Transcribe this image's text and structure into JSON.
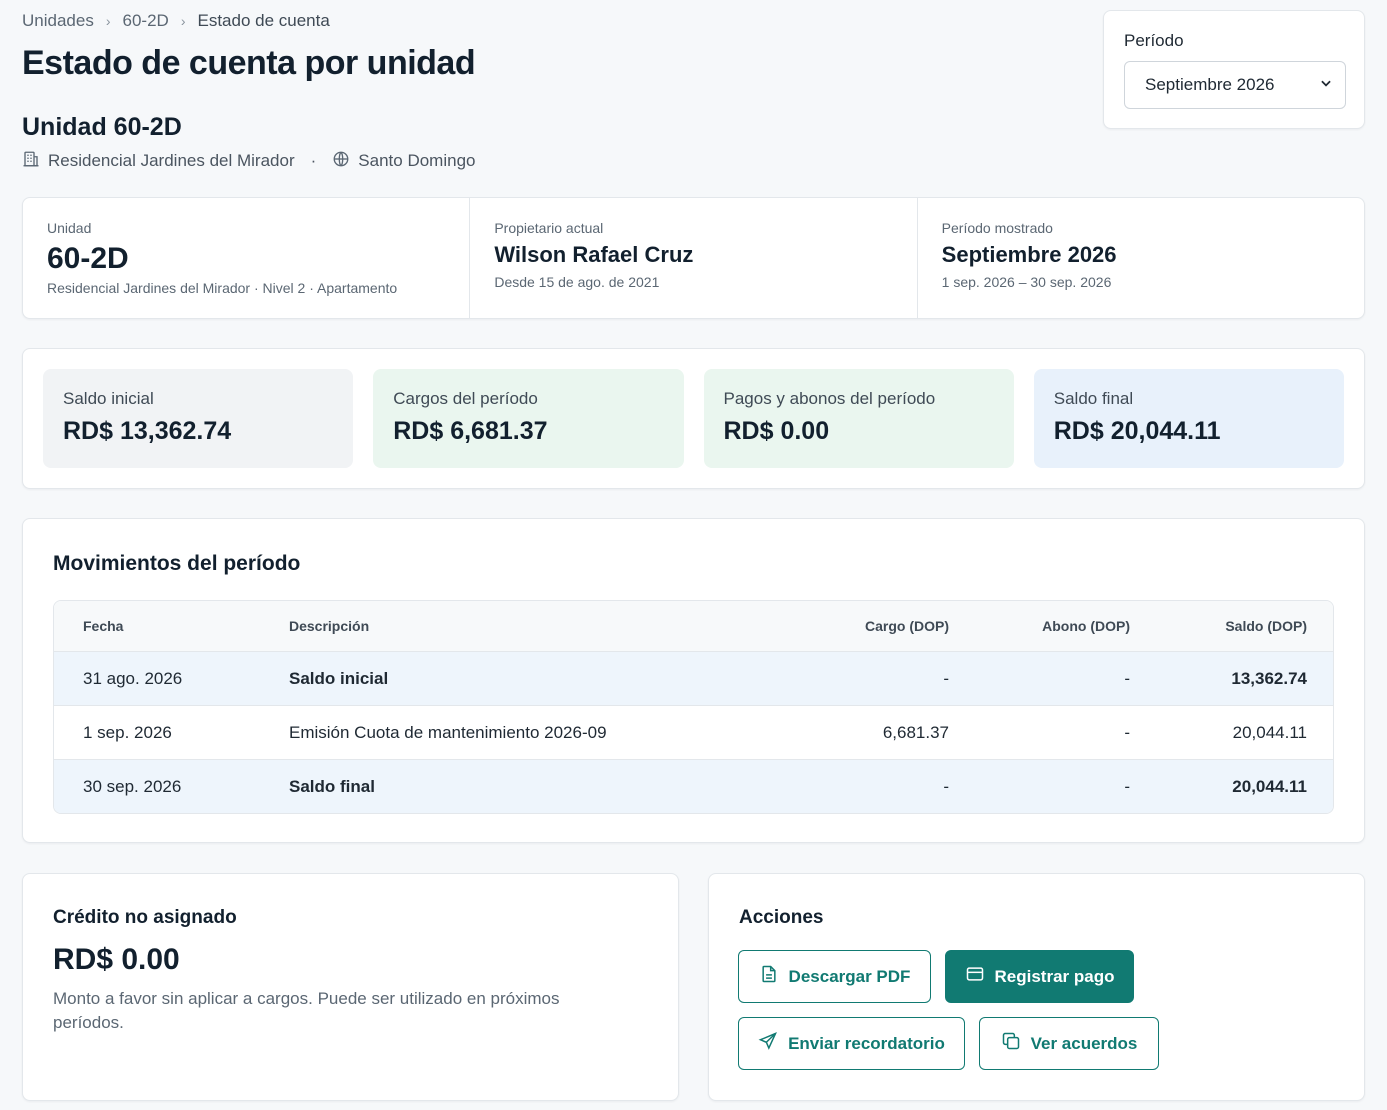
{
  "breadcrumb": {
    "items": [
      "Unidades",
      "60-2D",
      "Estado de cuenta"
    ]
  },
  "page_title": "Estado de cuenta por unidad",
  "unit_header": {
    "title": "Unidad 60-2D",
    "complex": "Residencial Jardines del Mirador",
    "city": "Santo Domingo"
  },
  "period_selector": {
    "label": "Período",
    "value": "Septiembre 2026"
  },
  "info": {
    "unit": {
      "label": "Unidad",
      "value": "60-2D",
      "detail": "Residencial Jardines del Mirador · Nivel 2 · Apartamento"
    },
    "owner": {
      "label": "Propietario actual",
      "value": "Wilson Rafael Cruz",
      "detail": "Desde 15 de ago. de 2021"
    },
    "period": {
      "label": "Período mostrado",
      "value": "Septiembre 2026",
      "detail": "1 sep. 2026 – 30 sep. 2026"
    }
  },
  "summary": [
    {
      "label": "Saldo inicial",
      "value": "RD$ 13,362.74"
    },
    {
      "label": "Cargos del período",
      "value": "RD$ 6,681.37"
    },
    {
      "label": "Pagos y abonos del período",
      "value": "RD$ 0.00"
    },
    {
      "label": "Saldo final",
      "value": "RD$ 20,044.11"
    }
  ],
  "movements": {
    "title": "Movimientos del período",
    "headers": [
      "Fecha",
      "Descripción",
      "Cargo (DOP)",
      "Abono (DOP)",
      "Saldo (DOP)"
    ],
    "rows": [
      {
        "date": "31 ago. 2026",
        "desc": "Saldo inicial",
        "cargo": "-",
        "abono": "-",
        "saldo": "13,362.74"
      },
      {
        "date": "1 sep. 2026",
        "desc": "Emisión Cuota de mantenimiento 2026-09",
        "cargo": "6,681.37",
        "abono": "-",
        "saldo": "20,044.11"
      },
      {
        "date": "30 sep. 2026",
        "desc": "Saldo final",
        "cargo": "-",
        "abono": "-",
        "saldo": "20,044.11"
      }
    ]
  },
  "credit": {
    "title": "Crédito no asignado",
    "value": "RD$ 0.00",
    "note": "Monto a favor sin aplicar a cargos. Puede ser utilizado en próximos períodos."
  },
  "actions": {
    "title": "Acciones",
    "download_pdf": "Descargar PDF",
    "register_payment": "Registrar pago",
    "send_reminder": "Enviar recordatorio",
    "view_agreements": "Ver acuerdos"
  },
  "colors": {
    "accent": "#117a72",
    "gray_tile": "#f1f3f5",
    "green_tile": "#eaf6ef",
    "blue_tile": "#e8f1fb"
  },
  "icons": {
    "complex": "building-icon",
    "city": "globe-icon",
    "select": "chevron-down-icon",
    "pdf": "file-text-icon",
    "payment": "credit-card-icon",
    "reminder": "send-icon",
    "agreements": "copy-icon"
  }
}
